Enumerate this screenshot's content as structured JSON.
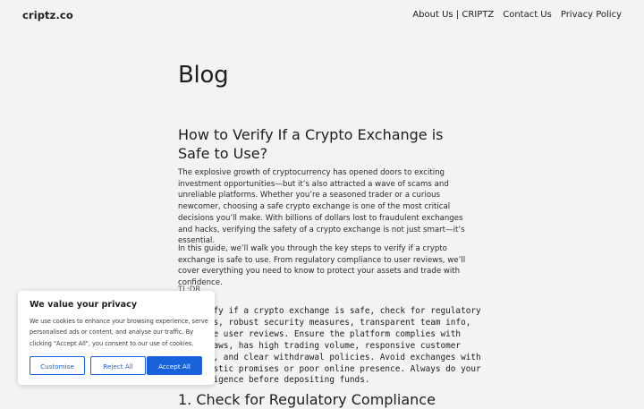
{
  "header": {
    "logo": "criptz.co",
    "nav": [
      "About Us | CRIPTZ",
      "Contact Us",
      "Privacy Policy"
    ]
  },
  "main": {
    "page_title": "Blog",
    "post_title": "How to Verify If a Crypto Exchange is Safe to Use?",
    "paragraphs": [
      "The explosive growth of cryptocurrency has opened doors to exciting investment opportunities—but it’s also attracted a wave of scams and unreliable platforms. Whether you’re a seasoned trader or a curious newcomer, choosing a safe crypto exchange is one of the most critical decisions you’ll make. With billions of dollars lost to fraudulent exchanges and hacks, verifying the safety of a crypto exchange is not just smart—it’s essential.",
      "In this guide, we’ll walk you through the key steps to verify if a crypto exchange is safe to use. From regulatory compliance to user reviews, we’ll cover everything you need to know to protect your assets and trade with confidence."
    ],
    "tldr_label": "TL;DR",
    "code_block": "To verify if a crypto exchange is safe, check for regulatory\nlicenses, robust security measures, transparent team info,\npositive user reviews. Ensure the platform complies with\nlocal laws, has high trading volume, responsive customer\nsupport, and clear withdrawal policies. Avoid exchanges with\nunrealistic promises or poor online presence. Always do your\ndue diligence before depositing funds.",
    "section_heading": "1. Check for Regulatory Compliance"
  },
  "cookie_banner": {
    "title": "We value your privacy",
    "text": "We use cookies to enhance your browsing experience, serve personalised ads or content, and analyse our traffic. By clicking \"Accept All\", you consent to our use of cookies.",
    "customise_label": "Customise",
    "reject_label": "Reject All",
    "accept_label": "Accept All",
    "accent_color": "#1863dc"
  }
}
